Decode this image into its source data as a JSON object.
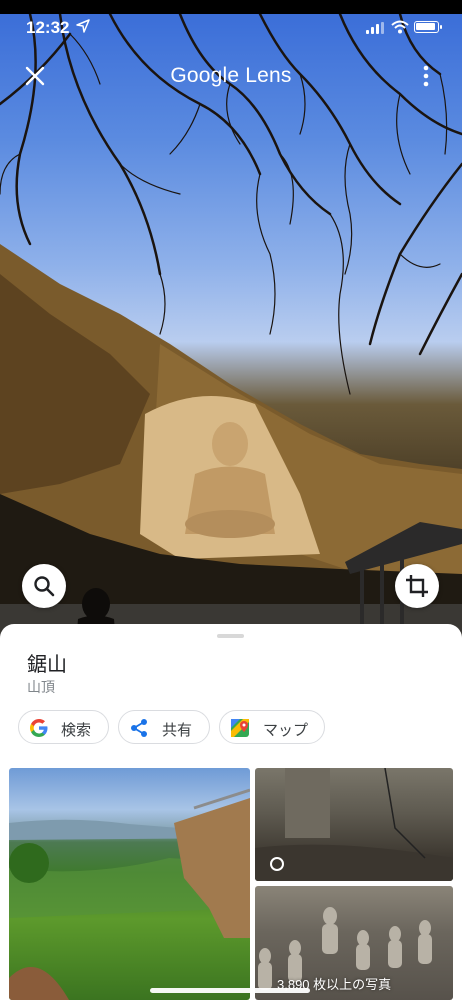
{
  "status_bar": {
    "time": "12:32"
  },
  "header": {
    "title": "Google Lens"
  },
  "result": {
    "title": "鋸山",
    "subtitle": "山頂"
  },
  "actions": [
    {
      "label": "検索",
      "icon": "google-g-icon"
    },
    {
      "label": "共有",
      "icon": "share-icon"
    },
    {
      "label": "マップ",
      "icon": "maps-icon"
    }
  ],
  "gallery": {
    "count_label": "3,890 枚以上の写真"
  },
  "colors": {
    "accent_blue": "#1a73e8",
    "google_red": "#ea4335",
    "google_yellow": "#fbbc04",
    "google_green": "#34a853"
  }
}
